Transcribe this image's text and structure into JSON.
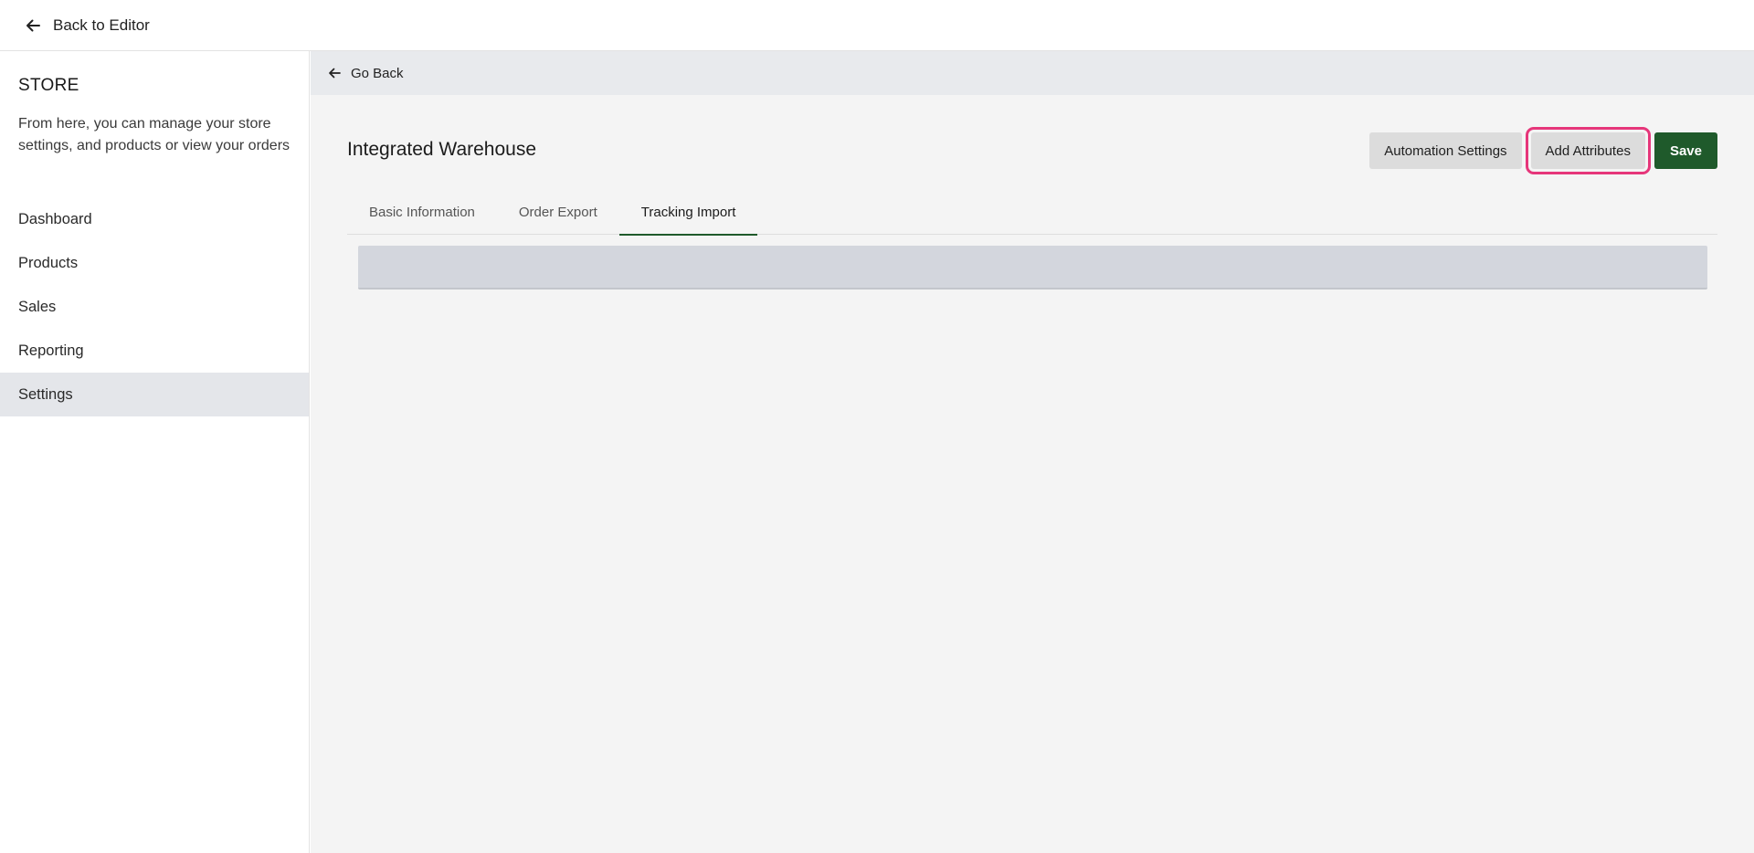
{
  "topbar": {
    "back_label": "Back to Editor",
    "back_icon": "arrow-left-icon"
  },
  "sidebar": {
    "title": "STORE",
    "description": "From here, you can manage your store settings, and products or view your orders",
    "items": [
      {
        "label": "Dashboard",
        "active": false
      },
      {
        "label": "Products",
        "active": false
      },
      {
        "label": "Sales",
        "active": false
      },
      {
        "label": "Reporting",
        "active": false
      },
      {
        "label": "Settings",
        "active": true
      }
    ]
  },
  "main": {
    "go_back_label": "Go Back",
    "go_back_icon": "arrow-left-icon",
    "title": "Integrated Warehouse",
    "actions": {
      "automation_label": "Automation Settings",
      "add_attributes_label": "Add Attributes",
      "save_label": "Save"
    },
    "tabs": [
      {
        "label": "Basic Information",
        "active": false
      },
      {
        "label": "Order Export",
        "active": false
      },
      {
        "label": "Tracking Import",
        "active": true
      }
    ]
  },
  "colors": {
    "accent_green": "#1f5a2b",
    "highlight_pink": "#e6367a",
    "active_nav_bg": "#e4e6ea"
  }
}
